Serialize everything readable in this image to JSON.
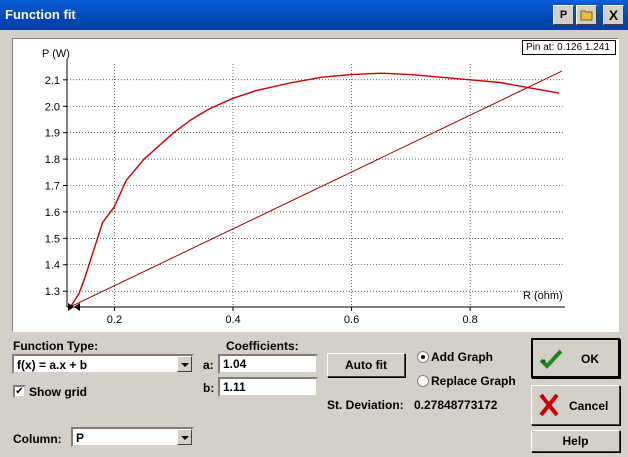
{
  "window": {
    "title": "Function fit",
    "p_button": "P",
    "close_label": "X"
  },
  "graph": {
    "pin_text": "Pin at: 0.126 1.241"
  },
  "chart_data": {
    "type": "line",
    "title": "",
    "ylabel": "P (W)",
    "xlabel": "R (ohm)",
    "xlim": [
      0.12,
      0.96
    ],
    "ylim": [
      1.24,
      2.16
    ],
    "x_ticks": [
      0.2,
      0.4,
      0.6,
      0.8
    ],
    "y_ticks": [
      1.3,
      1.4,
      1.5,
      1.6,
      1.7,
      1.8,
      1.9,
      2.0,
      2.1
    ],
    "grid": true,
    "series": [
      {
        "color": "#cc0000",
        "x": [
          0.126,
          0.14,
          0.15,
          0.16,
          0.18,
          0.2,
          0.22,
          0.25,
          0.28,
          0.3,
          0.33,
          0.36,
          0.4,
          0.44,
          0.5,
          0.55,
          0.6,
          0.65,
          0.7,
          0.75,
          0.8,
          0.85,
          0.9,
          0.95
        ],
        "y": [
          1.241,
          1.29,
          1.35,
          1.42,
          1.56,
          1.62,
          1.72,
          1.8,
          1.86,
          1.9,
          1.95,
          1.99,
          2.03,
          2.06,
          2.09,
          2.11,
          2.12,
          2.125,
          2.12,
          2.11,
          2.1,
          2.09,
          2.07,
          2.05
        ]
      },
      {
        "color": "#990000",
        "x": [
          0.126,
          0.955
        ],
        "y": [
          1.241,
          2.133
        ]
      }
    ]
  },
  "controls": {
    "function_type_label": "Function Type:",
    "function_type_value": "f(x) = a.x + b",
    "coefficients_label": "Coefficients:",
    "a_label": "a:",
    "a_value": "1.04",
    "b_label": "b:",
    "b_value": "1.11",
    "auto_fit_label": "Auto fit",
    "add_graph_label": "Add Graph",
    "replace_graph_label": "Replace Graph",
    "st_dev_label": "St. Deviation:",
    "st_dev_value": "0.27848773172",
    "show_grid_label": "Show grid",
    "column_label": "Column:",
    "column_value": "P",
    "ok_label": "OK",
    "cancel_label": "Cancel",
    "help_label": "Help"
  }
}
